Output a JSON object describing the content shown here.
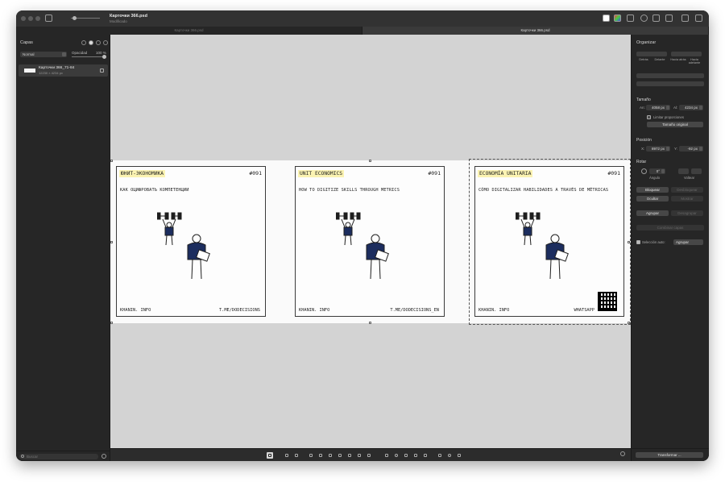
{
  "window": {
    "doc_title": "Карточки 366.psd",
    "doc_status": "Modificado"
  },
  "tabs": [
    {
      "label": "Карточки 366.psd",
      "active": false
    },
    {
      "label": "Карточки 366.psd",
      "active": true
    }
  ],
  "layers_panel": {
    "title": "Capas",
    "blend_mode": "Normal",
    "opacity_label": "Opacidad",
    "opacity_value": "100 %",
    "opacity_fraction": 1.0,
    "layer": {
      "name": "Карточки 366_71-84",
      "dimensions": "12230 × 4234 px"
    },
    "search_placeholder": "Buscar"
  },
  "cards": [
    {
      "header": "ЮНИТ-ЭКОНОМИКА",
      "number": "#091",
      "subtitle": "КАК ОЦИФРОВАТЬ КОМПЕТЕНЦИИ",
      "footer_left": "KHANIN. INFO",
      "footer_right": "T.ME/DODECISIONS",
      "has_qr": false
    },
    {
      "header": "UNIT ECONOMICS",
      "number": "#091",
      "subtitle": "HOW TO DIGITIZE SKILLS THROUGH METRICS",
      "footer_left": "KHANIN. INFO",
      "footer_right": "T.ME/DODECISIONS_EN",
      "has_qr": false
    },
    {
      "header": "ECONOMÍA UNITARIA",
      "number": "#091",
      "subtitle": "CÓMO DIGITALIZAR HABILIDADES A TRAVÉS DE MÉTRICAS",
      "footer_left": "KHANIN. INFO",
      "footer_right": "WHATSAPP",
      "has_qr": true
    }
  ],
  "inspector": {
    "title": "Organizar",
    "arrange_buttons": [
      "Detrás",
      "Delante",
      "Hacia atrás",
      "Hacia adelante"
    ],
    "size_section": "Tamaño",
    "width_label": "An:",
    "width_value": "4058 px",
    "height_label": "Al:",
    "height_value": "4234 px",
    "constrain_label": "Limitar proporciones",
    "original_size_button": "Tamaño original",
    "position_section": "Posición",
    "x_label": "X:",
    "x_value": "8972 px",
    "y_label": "Y:",
    "y_value": "-92 px",
    "rotate_section": "Rotar",
    "angle_value": "0°",
    "angle_label": "Ángulo",
    "flip_label": "Voltear",
    "lock_button": "Bloquear",
    "unlock_button": "Desbloquear",
    "hide_button": "Ocultar",
    "show_button": "Mostrar",
    "group_button": "Agrupar",
    "ungroup_button": "Desagrupar",
    "combine_button": "Combinar capas",
    "auto_select_label": "Selección auto:",
    "auto_select_value": "Agrupar",
    "transform_button": "Transformar ..."
  },
  "icons": [
    "sidebar-icon",
    "zoom-icon",
    "color-swatch-icon",
    "info-icon",
    "share-icon",
    "search-icon",
    "add-icon",
    "select-tool-icon",
    "brush-tool-icon",
    "hand-tool-icon",
    "zoom-tool-icon",
    "crop-tool-icon"
  ],
  "colors": {
    "card_highlight": "#fbf3b2",
    "figure_blue": "#1c2d5e",
    "canvas_bg": "#d3d3d3",
    "panel_bg": "#262626"
  }
}
